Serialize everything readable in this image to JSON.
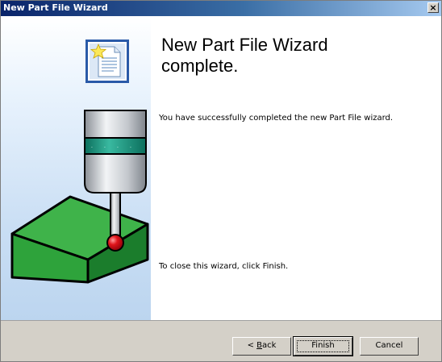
{
  "window": {
    "title": "New Part File Wizard",
    "close_glyph": "×"
  },
  "content": {
    "heading": "New Part File Wizard\ncomplete.",
    "message": "You have successfully completed the new Part File wizard.",
    "close_instruction": "To close this wizard, click Finish."
  },
  "buttons": {
    "back": {
      "prefix": "< ",
      "mnemonic": "B",
      "rest": "ack"
    },
    "finish": "Finish",
    "cancel": "Cancel"
  },
  "icons": [
    "document-star-icon",
    "probe-icon",
    "part-block-icon",
    "close-icon"
  ]
}
